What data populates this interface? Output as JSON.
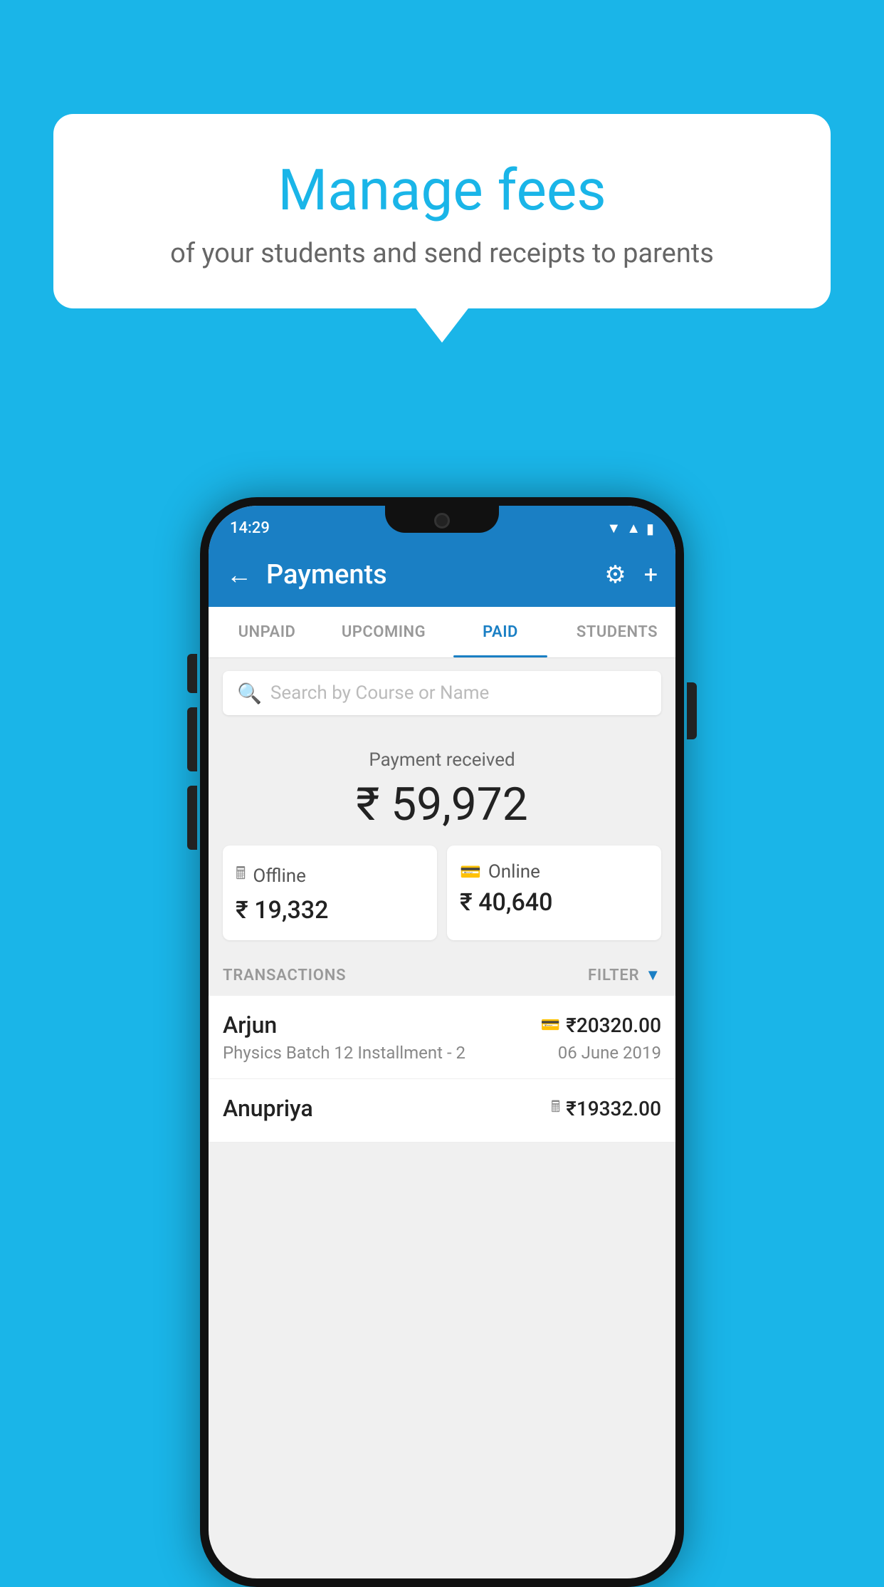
{
  "background_color": "#1ab5e8",
  "speech_bubble": {
    "title": "Manage fees",
    "subtitle": "of your students and send receipts to parents"
  },
  "status_bar": {
    "time": "14:29",
    "icons": [
      "wifi",
      "signal",
      "battery"
    ]
  },
  "app_bar": {
    "title": "Payments",
    "back_label": "←",
    "settings_label": "⚙",
    "add_label": "+"
  },
  "tabs": [
    {
      "label": "UNPAID",
      "active": false
    },
    {
      "label": "UPCOMING",
      "active": false
    },
    {
      "label": "PAID",
      "active": true
    },
    {
      "label": "STUDENTS",
      "active": false
    }
  ],
  "search": {
    "placeholder": "Search by Course or Name"
  },
  "payment": {
    "label": "Payment received",
    "amount": "₹ 59,972",
    "offline": {
      "label": "Offline",
      "amount": "₹ 19,332"
    },
    "online": {
      "label": "Online",
      "amount": "₹ 40,640"
    }
  },
  "transactions": {
    "section_label": "TRANSACTIONS",
    "filter_label": "FILTER",
    "items": [
      {
        "name": "Arjun",
        "amount": "₹20320.00",
        "description": "Physics Batch 12 Installment - 2",
        "date": "06 June 2019",
        "payment_type": "card"
      },
      {
        "name": "Anupriya",
        "amount": "₹19332.00",
        "description": "",
        "date": "",
        "payment_type": "offline"
      }
    ]
  }
}
